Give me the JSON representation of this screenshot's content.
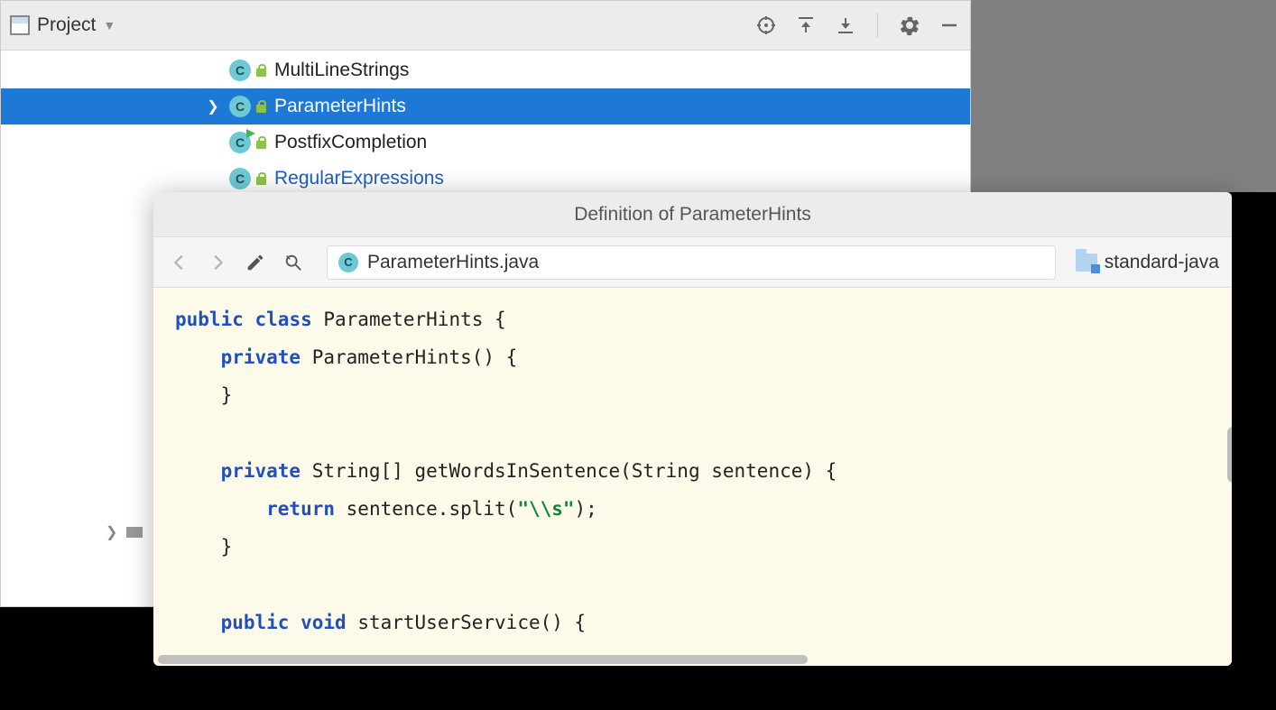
{
  "panel": {
    "title": "Project"
  },
  "tree": {
    "items": [
      {
        "label": "MultiLineStrings",
        "selected": false,
        "expandable": false,
        "runnable": false,
        "link": false
      },
      {
        "label": "ParameterHints",
        "selected": true,
        "expandable": true,
        "runnable": false,
        "link": false
      },
      {
        "label": "PostfixCompletion",
        "selected": false,
        "expandable": false,
        "runnable": true,
        "link": false
      },
      {
        "label": "RegularExpressions",
        "selected": false,
        "expandable": false,
        "runnable": false,
        "link": true
      }
    ]
  },
  "definition": {
    "title": "Definition of ParameterHints",
    "file": "ParameterHints.java",
    "module": "standard-java",
    "code": {
      "l1a": "public",
      "l1b": "class",
      "l1c": " ParameterHints {",
      "l2a": "    private",
      "l2b": " ParameterHints() {",
      "l3": "    }",
      "l4": "",
      "l5a": "    private",
      "l5b": " String[] getWordsInSentence(String sentence) {",
      "l6a": "        return",
      "l6b": " sentence.split(",
      "l6c": "\"\\\\s\"",
      "l6d": ");",
      "l7": "    }",
      "l8": "",
      "l9a": "    public",
      "l9b": "void",
      "l9c": " startUserService() {"
    }
  }
}
